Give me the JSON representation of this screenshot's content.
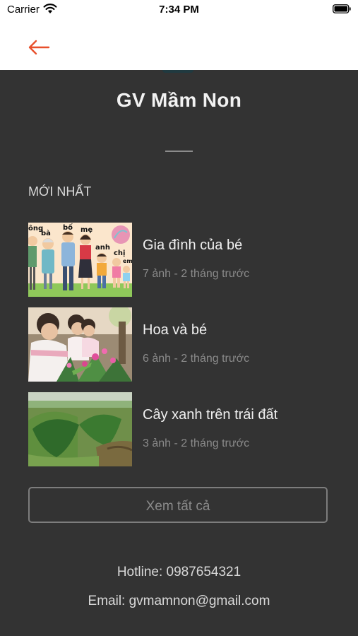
{
  "status_bar": {
    "carrier": "Carrier",
    "time": "7:34 PM"
  },
  "nav": {
    "back_icon": "arrow-left-icon",
    "accent_color": "#e8502c"
  },
  "profile": {
    "title": "GV Mầm Non"
  },
  "section": {
    "heading": "MỚI NHẤT"
  },
  "albums": [
    {
      "name": "Gia đình của bé",
      "meta": "7 ảnh - 2 tháng trước",
      "thumb_words": [
        "ông",
        "bà",
        "bố",
        "mẹ",
        "anh",
        "chị",
        "em"
      ]
    },
    {
      "name": "Hoa và bé",
      "meta": "6 ảnh - 2 tháng trước"
    },
    {
      "name": "Cây xanh trên trái đất",
      "meta": "3 ảnh - 2 tháng trước"
    }
  ],
  "see_all_label": "Xem tất cả",
  "contact": {
    "hotline": "Hotline: 0987654321",
    "email": "Email: gvmamnon@gmail.com"
  }
}
